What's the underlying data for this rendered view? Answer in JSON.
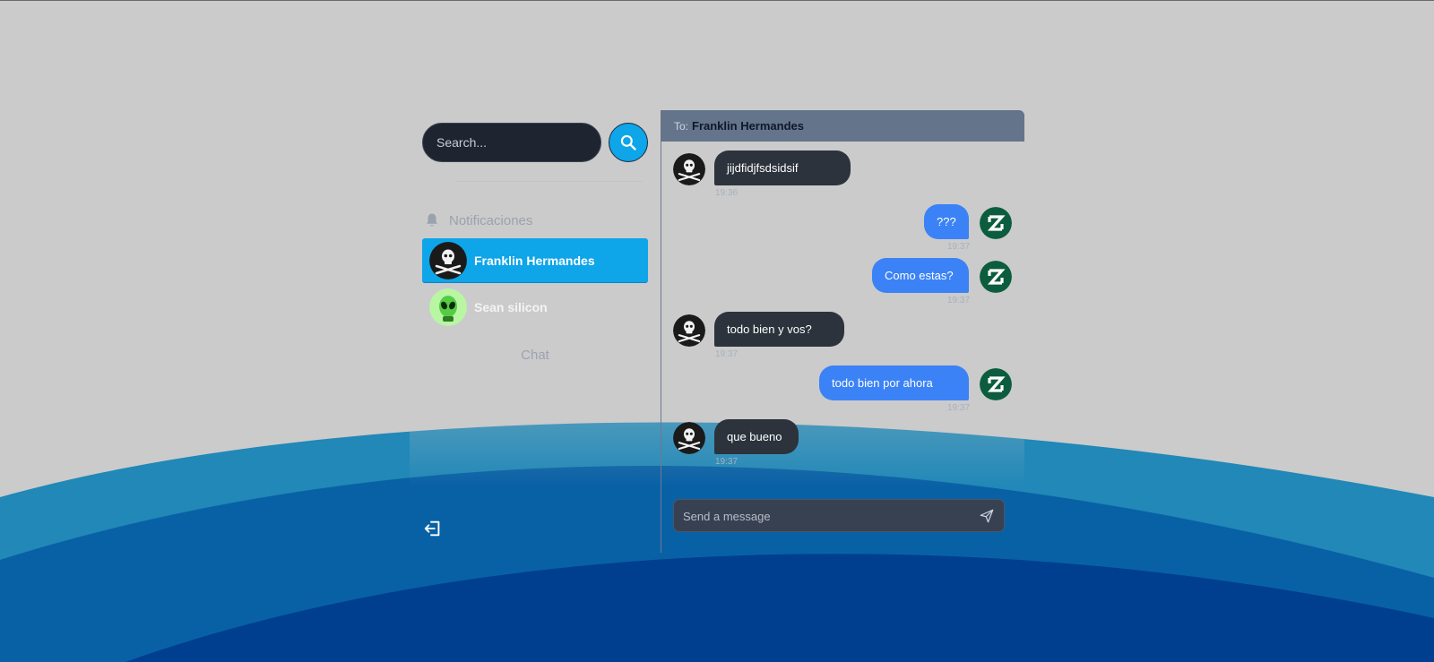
{
  "search": {
    "placeholder": "Search..."
  },
  "sidebar": {
    "notifications_label": "Notificaciones",
    "contacts": [
      {
        "name": "Franklin Hermandes",
        "active": true
      },
      {
        "name": "Sean silicon",
        "active": false
      }
    ],
    "chat_label": "Chat"
  },
  "chat": {
    "to_label": "To:",
    "recipient": "Franklin Hermandes",
    "messages": [
      {
        "text": "jijdfidjfsdsidsif",
        "time": "19:36",
        "direction": "in"
      },
      {
        "text": "???",
        "time": "19:37",
        "direction": "out"
      },
      {
        "text": "Como estas?",
        "time": "19:37",
        "direction": "out"
      },
      {
        "text": "todo bien y vos?",
        "time": "19:37",
        "direction": "in"
      },
      {
        "text": "todo bien por ahora",
        "time": "19:37",
        "direction": "out"
      },
      {
        "text": "que bueno",
        "time": "19:37",
        "direction": "in"
      }
    ],
    "composer_placeholder": "Send a message"
  },
  "icons": {
    "search": "search-icon",
    "bell": "bell-icon",
    "logout": "logout-icon",
    "send": "send-icon",
    "pirate_avatar": "jolly-roger-avatar",
    "alien_avatar": "alien-avatar",
    "user_avatar": "z-logo-avatar"
  },
  "colors": {
    "accent": "#0ea5e9",
    "outgoing_bubble": "#3b82f6",
    "incoming_bubble": "#2c333c",
    "header": "#64748b",
    "background": "#cbcbcb"
  }
}
